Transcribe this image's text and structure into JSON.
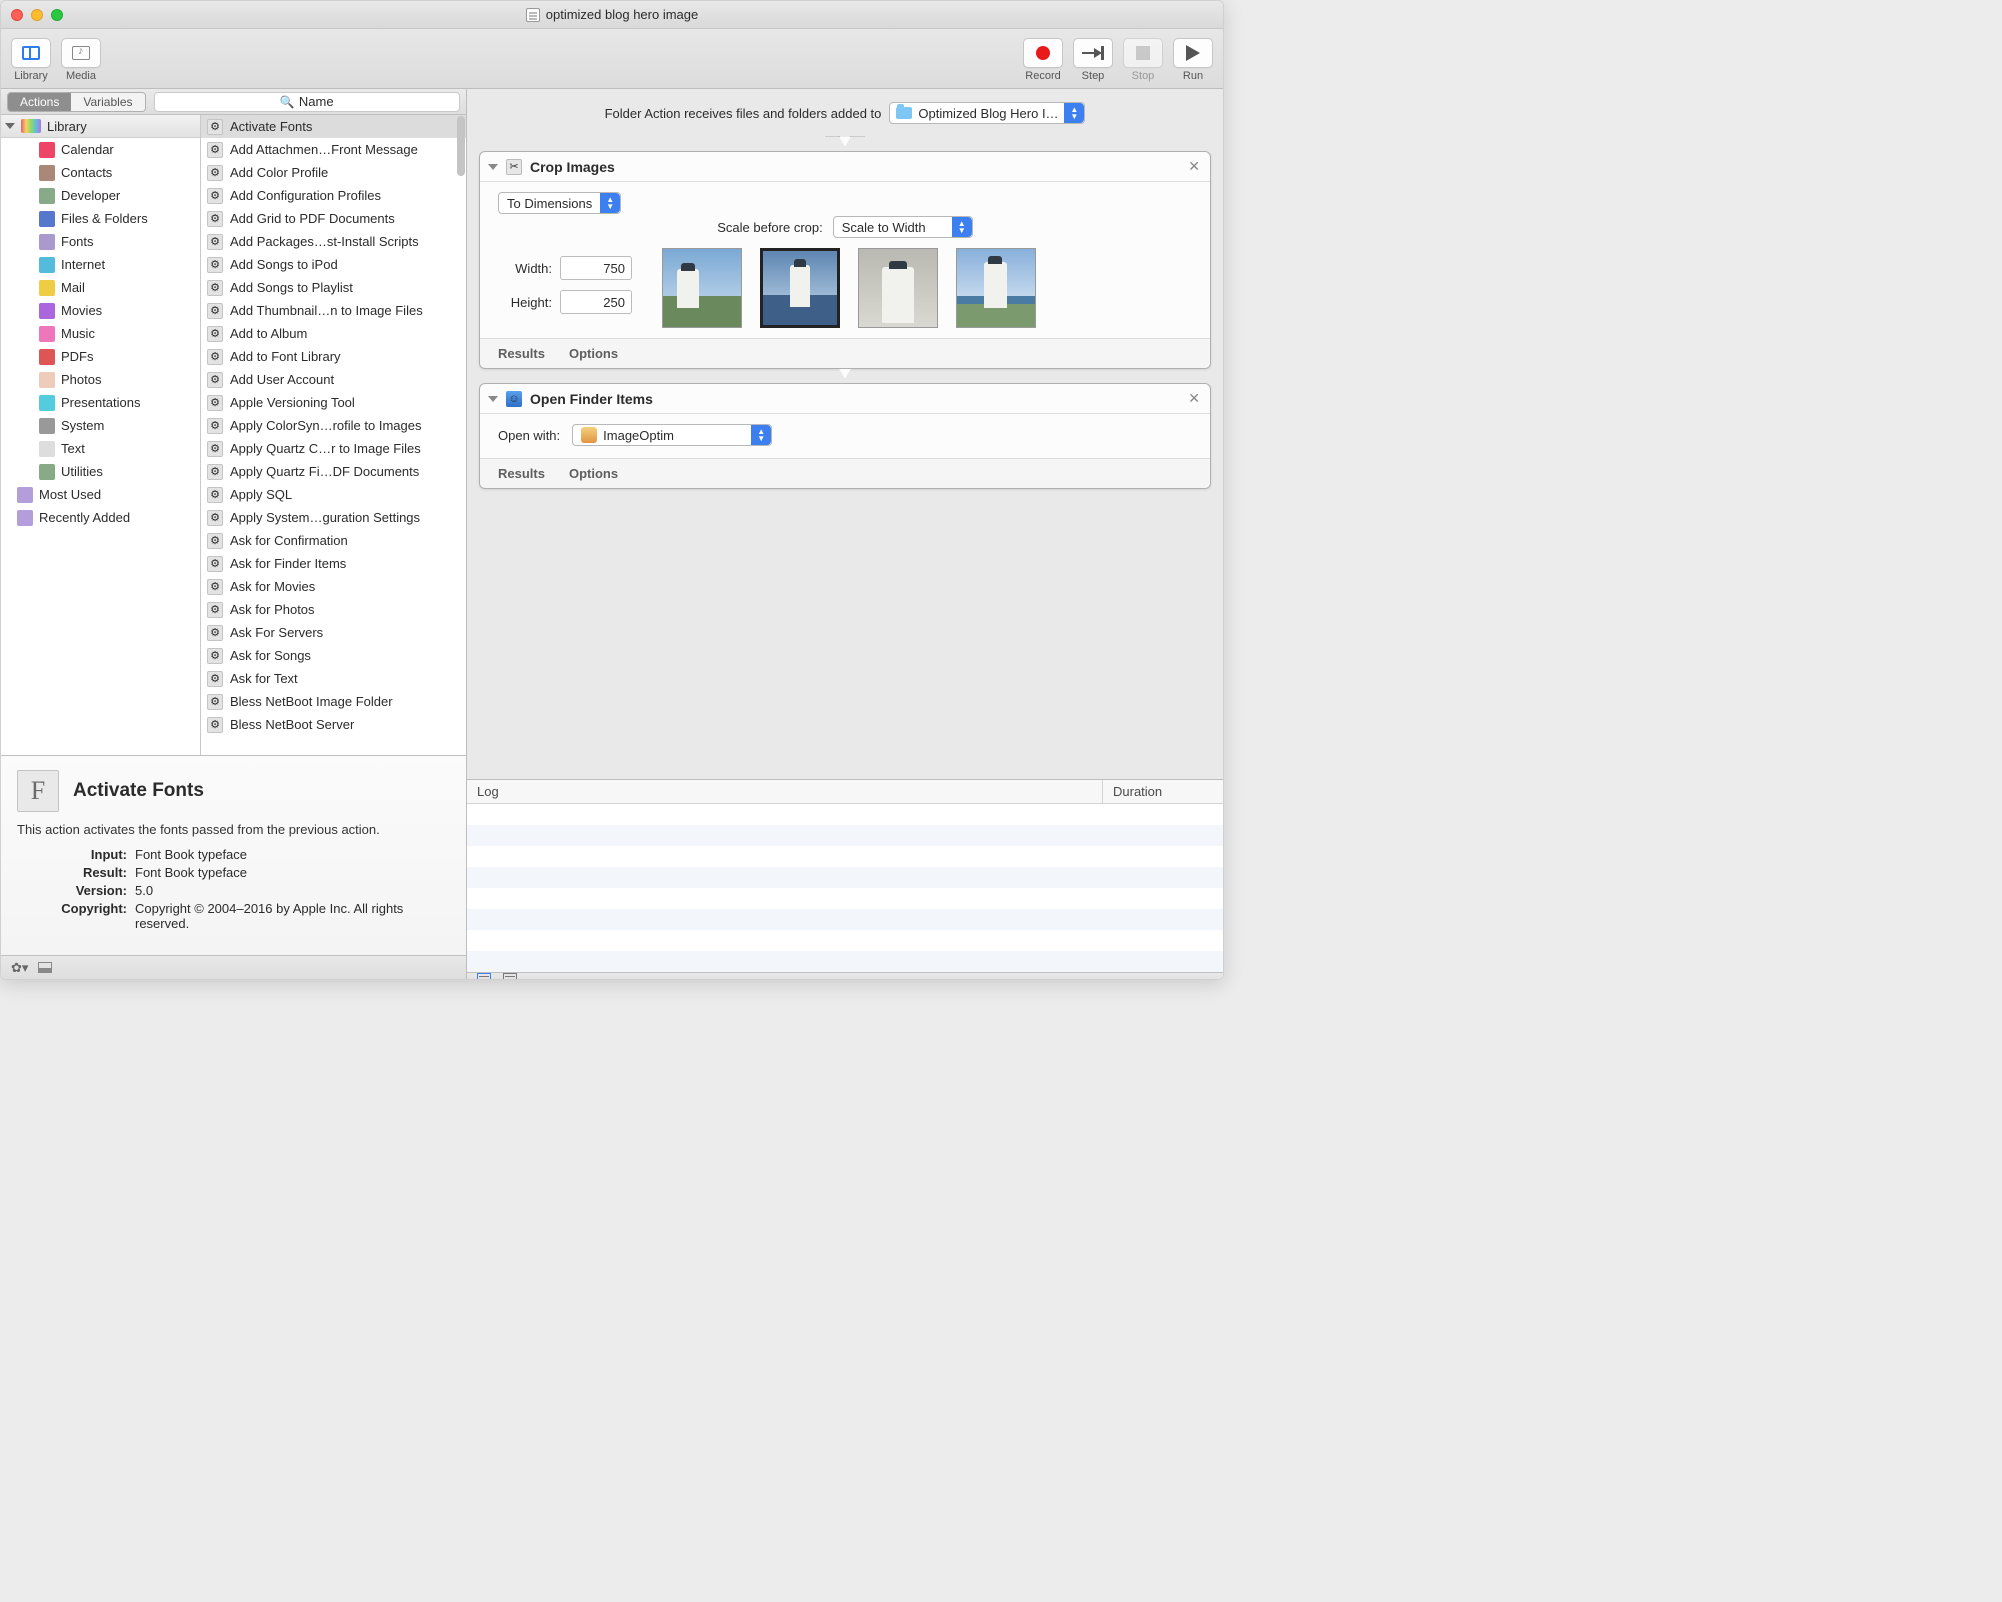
{
  "window": {
    "title": "optimized blog hero image"
  },
  "toolbar": {
    "left": [
      {
        "id": "library",
        "label": "Library"
      },
      {
        "id": "media",
        "label": "Media"
      }
    ],
    "right": [
      {
        "id": "record",
        "label": "Record"
      },
      {
        "id": "step",
        "label": "Step"
      },
      {
        "id": "stop",
        "label": "Stop"
      },
      {
        "id": "run",
        "label": "Run"
      }
    ]
  },
  "sidebar_tabs": {
    "actions": "Actions",
    "variables": "Variables",
    "search_placeholder": "Name"
  },
  "library": {
    "header": "Library",
    "categories": [
      "Calendar",
      "Contacts",
      "Developer",
      "Files & Folders",
      "Fonts",
      "Internet",
      "Mail",
      "Movies",
      "Music",
      "PDFs",
      "Photos",
      "Presentations",
      "System",
      "Text",
      "Utilities"
    ],
    "smart": [
      {
        "label": "Most Used"
      },
      {
        "label": "Recently Added"
      }
    ]
  },
  "actions": [
    "Activate Fonts",
    "Add Attachmen…Front Message",
    "Add Color Profile",
    "Add Configuration Profiles",
    "Add Grid to PDF Documents",
    "Add Packages…st-Install Scripts",
    "Add Songs to iPod",
    "Add Songs to Playlist",
    "Add Thumbnail…n to Image Files",
    "Add to Album",
    "Add to Font Library",
    "Add User Account",
    "Apple Versioning Tool",
    "Apply ColorSyn…rofile to Images",
    "Apply Quartz C…r to Image Files",
    "Apply Quartz Fi…DF Documents",
    "Apply SQL",
    "Apply System…guration Settings",
    "Ask for Confirmation",
    "Ask for Finder Items",
    "Ask for Movies",
    "Ask for Photos",
    "Ask For Servers",
    "Ask for Songs",
    "Ask for Text",
    "Bless NetBoot Image Folder",
    "Bless NetBoot Server"
  ],
  "selected_action_index": 0,
  "detail": {
    "title": "Activate Fonts",
    "description": "This action activates the fonts passed from the previous action.",
    "input_label": "Input:",
    "input_value": "Font Book typeface",
    "result_label": "Result:",
    "result_value": "Font Book typeface",
    "version_label": "Version:",
    "version_value": "5.0",
    "copyright_label": "Copyright:",
    "copyright_value": "Copyright © 2004–2016 by Apple Inc. All rights reserved."
  },
  "workflow": {
    "receives_text": "Folder Action receives files and folders added to",
    "receives_folder": "Optimized Blog Hero I…",
    "cards": {
      "crop": {
        "title": "Crop Images",
        "mode": "To Dimensions",
        "scale_label": "Scale before crop:",
        "scale_value": "Scale to Width",
        "width_label": "Width:",
        "width_value": "750",
        "height_label": "Height:",
        "height_value": "250",
        "results": "Results",
        "options": "Options"
      },
      "open": {
        "title": "Open Finder Items",
        "openwith_label": "Open with:",
        "openwith_value": "ImageOptim",
        "results": "Results",
        "options": "Options"
      }
    }
  },
  "log": {
    "col1": "Log",
    "col2": "Duration"
  }
}
